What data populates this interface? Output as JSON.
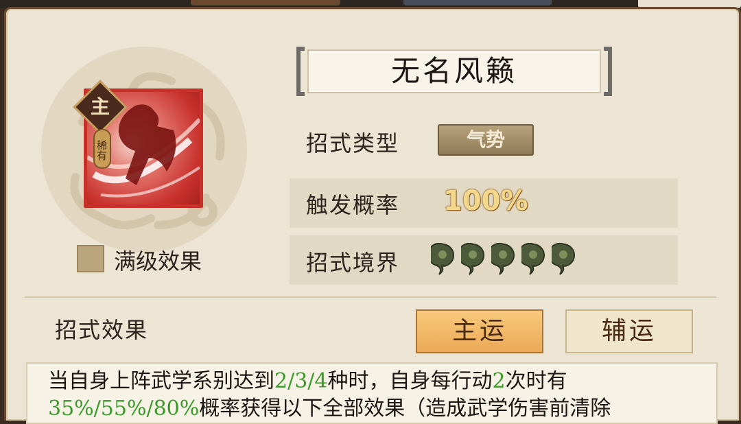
{
  "skill": {
    "name": "无名风籁",
    "main_badge": "主",
    "rarity": "稀有"
  },
  "max_level": {
    "label": "满级效果",
    "checked": false
  },
  "attributes": {
    "type_label": "招式类型",
    "type_value": "气势",
    "rate_label": "触发概率",
    "rate_value": "100%",
    "realm_label": "招式境界",
    "realm_level": 5
  },
  "effect": {
    "title": "招式效果",
    "tab_main": "主运",
    "tab_aux": "辅运",
    "selected_tab": "主运",
    "text_line1_a": "当自身上阵武学系别达到",
    "text_line1_b": "2/3/4",
    "text_line1_c": "种时，自身每行动",
    "text_line1_d": "2",
    "text_line1_e": "次时有",
    "text_line2_a": "35%/55%/80%",
    "text_line2_b": "概率获得以下全部效果（造成武学伤害前清除"
  },
  "colors": {
    "highlight_green": "#3a9a2a",
    "tab_active": "#eba957",
    "skill_red": "#c8302a"
  }
}
